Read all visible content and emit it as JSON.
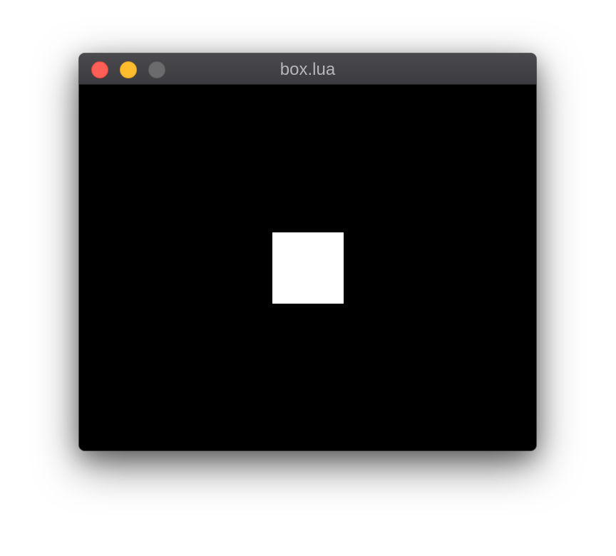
{
  "window": {
    "title": "box.lua",
    "controls": [
      {
        "name": "close",
        "color": "#ff5f57"
      },
      {
        "name": "minimize",
        "color": "#febc2e"
      },
      {
        "name": "zoom",
        "color": "#6b6b6d"
      }
    ]
  },
  "canvas": {
    "background_color": "#000000",
    "box_color": "#ffffff"
  }
}
